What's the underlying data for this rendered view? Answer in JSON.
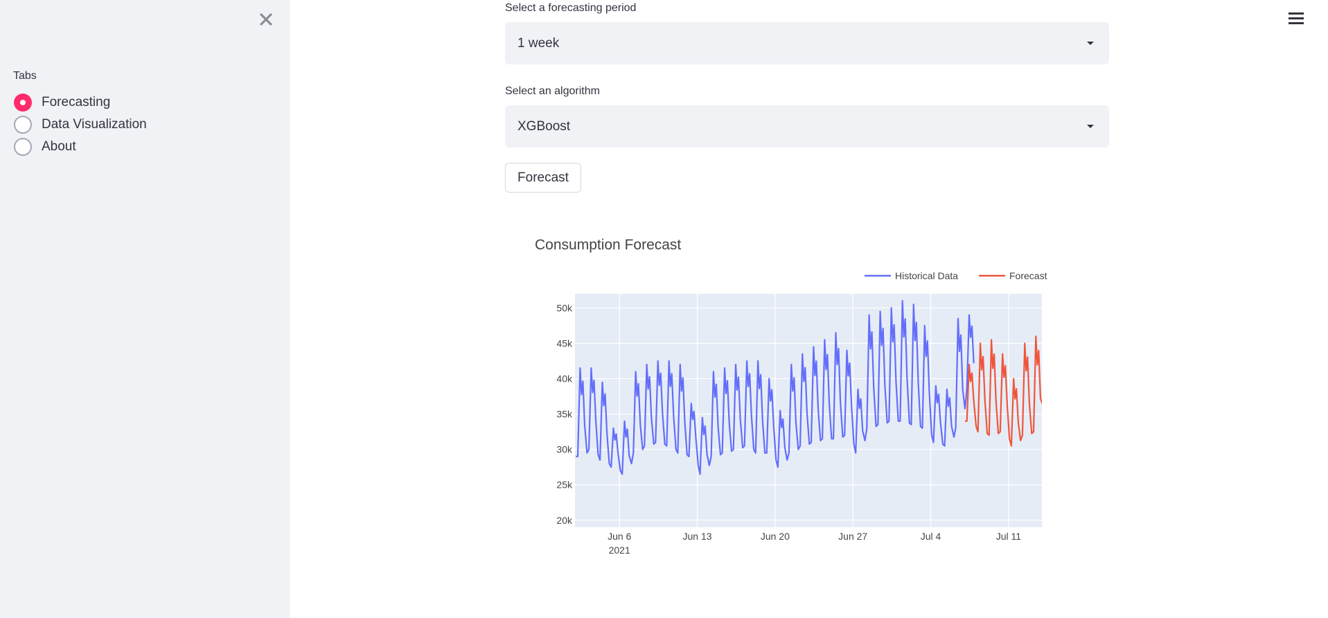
{
  "sidebar": {
    "tabs_label": "Tabs",
    "items": [
      {
        "label": "Forecasting",
        "selected": true
      },
      {
        "label": "Data Visualization",
        "selected": false
      },
      {
        "label": "About",
        "selected": false
      }
    ]
  },
  "main": {
    "period_label": "Select a forecasting period",
    "period_value": "1 week",
    "algorithm_label": "Select an algorithm",
    "algorithm_value": "XGBoost",
    "forecast_button": "Forecast"
  },
  "icons": {
    "close": "close-icon",
    "menu": "hamburger-menu-icon",
    "dropdown": "caret-down-icon"
  },
  "colors": {
    "accent": "#ff2b6b",
    "historical": "#636efa",
    "forecast": "#ef553b",
    "plot_bg": "#e5ecf6"
  },
  "chart_data": {
    "type": "line",
    "title": "Consumption Forecast",
    "xlabel": "",
    "ylabel": "",
    "x_range": [
      "2021-06-02",
      "2021-07-14"
    ],
    "ylim": [
      19000,
      52000
    ],
    "y_ticks": [
      20000,
      25000,
      30000,
      35000,
      40000,
      45000,
      50000
    ],
    "y_tick_labels": [
      "20k",
      "25k",
      "30k",
      "35k",
      "40k",
      "45k",
      "50k"
    ],
    "x_ticks": [
      "2021-06-06",
      "2021-06-13",
      "2021-06-20",
      "2021-06-27",
      "2021-07-04",
      "2021-07-11"
    ],
    "x_tick_labels": [
      "Jun 6",
      "Jun 13",
      "Jun 20",
      "Jun 27",
      "Jul 4",
      "Jul 11"
    ],
    "x_year_label": "2021",
    "legend_position": "top-right",
    "grid": true,
    "series": [
      {
        "name": "Historical Data",
        "daily": [
          {
            "date": "2021-06-02",
            "peak": 41500,
            "trough": 29000
          },
          {
            "date": "2021-06-03",
            "peak": 41500,
            "trough": 30000
          },
          {
            "date": "2021-06-04",
            "peak": 39500,
            "trough": 28500
          },
          {
            "date": "2021-06-05",
            "peak": 33000,
            "trough": 27500
          },
          {
            "date": "2021-06-06",
            "peak": 34000,
            "trough": 26500
          },
          {
            "date": "2021-06-07",
            "peak": 41000,
            "trough": 29500
          },
          {
            "date": "2021-06-08",
            "peak": 42000,
            "trough": 30500
          },
          {
            "date": "2021-06-09",
            "peak": 42500,
            "trough": 31000
          },
          {
            "date": "2021-06-10",
            "peak": 42500,
            "trough": 30500
          },
          {
            "date": "2021-06-11",
            "peak": 42000,
            "trough": 29500
          },
          {
            "date": "2021-06-12",
            "peak": 36500,
            "trough": 29000
          },
          {
            "date": "2021-06-13",
            "peak": 34500,
            "trough": 26500
          },
          {
            "date": "2021-06-14",
            "peak": 41000,
            "trough": 29000
          },
          {
            "date": "2021-06-15",
            "peak": 41500,
            "trough": 29500
          },
          {
            "date": "2021-06-16",
            "peak": 42000,
            "trough": 30000
          },
          {
            "date": "2021-06-17",
            "peak": 42500,
            "trough": 30500
          },
          {
            "date": "2021-06-18",
            "peak": 42500,
            "trough": 29500
          },
          {
            "date": "2021-06-19",
            "peak": 40000,
            "trough": 29500
          },
          {
            "date": "2021-06-20",
            "peak": 35500,
            "trough": 27500
          },
          {
            "date": "2021-06-21",
            "peak": 42000,
            "trough": 29500
          },
          {
            "date": "2021-06-22",
            "peak": 43500,
            "trough": 30500
          },
          {
            "date": "2021-06-23",
            "peak": 44500,
            "trough": 31000
          },
          {
            "date": "2021-06-24",
            "peak": 45500,
            "trough": 31500
          },
          {
            "date": "2021-06-25",
            "peak": 46500,
            "trough": 31500
          },
          {
            "date": "2021-06-26",
            "peak": 44000,
            "trough": 32000
          },
          {
            "date": "2021-06-27",
            "peak": 38500,
            "trough": 29500
          },
          {
            "date": "2021-06-28",
            "peak": 49000,
            "trough": 33000
          },
          {
            "date": "2021-06-29",
            "peak": 49500,
            "trough": 33500
          },
          {
            "date": "2021-06-30",
            "peak": 50000,
            "trough": 34000
          },
          {
            "date": "2021-07-01",
            "peak": 51000,
            "trough": 34000
          },
          {
            "date": "2021-07-02",
            "peak": 50500,
            "trough": 33500
          },
          {
            "date": "2021-07-03",
            "peak": 47500,
            "trough": 33000
          },
          {
            "date": "2021-07-04",
            "peak": 39000,
            "trough": 31000
          },
          {
            "date": "2021-07-05",
            "peak": 38500,
            "trough": 30500
          },
          {
            "date": "2021-07-06",
            "peak": 48500,
            "trough": 33000
          },
          {
            "date": "2021-07-07",
            "peak": 49000,
            "trough": 38500
          }
        ]
      },
      {
        "name": "Forecast",
        "daily": [
          {
            "date": "2021-07-07",
            "peak": 42000,
            "trough": 34000
          },
          {
            "date": "2021-07-08",
            "peak": 45000,
            "trough": 32500
          },
          {
            "date": "2021-07-09",
            "peak": 45500,
            "trough": 32000
          },
          {
            "date": "2021-07-10",
            "peak": 43500,
            "trough": 32500
          },
          {
            "date": "2021-07-11",
            "peak": 40000,
            "trough": 30500
          },
          {
            "date": "2021-07-12",
            "peak": 45000,
            "trough": 32000
          },
          {
            "date": "2021-07-13",
            "peak": 46000,
            "trough": 32500
          },
          {
            "date": "2021-07-14",
            "peak": 45500,
            "trough": 40000
          }
        ]
      }
    ]
  }
}
